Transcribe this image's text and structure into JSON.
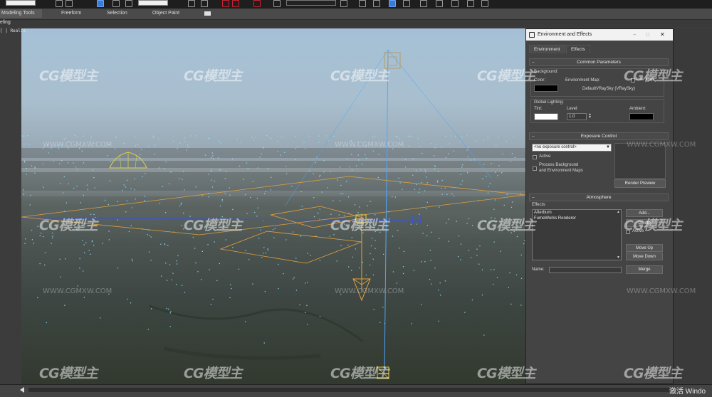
{
  "ribbon": {
    "tabs": [
      "Modeling Tools",
      "Freeform",
      "Selection",
      "Object Paint"
    ],
    "subtab": "eling"
  },
  "viewport": {
    "label": "[ | Realis"
  },
  "dialog": {
    "title": "Environment and Effects",
    "min_btn": "–",
    "max_btn": "□",
    "close_btn": "✕",
    "tabs": [
      "Environment",
      "Effects"
    ],
    "common": {
      "header": "Common Parameters",
      "background": "Background:",
      "color": "Color:",
      "env_map": "Environment Map:",
      "use_map": "Use Map",
      "map_name": "DefaultVRaySky  (VRaySky)",
      "global_lighting": "Global Lighting:",
      "tint": "Tint:",
      "level": "Level:",
      "level_value": "1.0",
      "ambient": "Ambient:"
    },
    "exposure": {
      "header": "Exposure Control",
      "selection": "<no exposure control>",
      "active": "Active",
      "process_bg_line1": "Process Background",
      "process_bg_line2": "and Environment Maps",
      "render_preview": "Render Preview"
    },
    "atmosphere": {
      "header": "Atmosphere",
      "effects_label": "Effects:",
      "effects": [
        "Afterburn",
        "FumeWorks Renderer"
      ],
      "add": "Add...",
      "delete": "Delete",
      "active": "Active",
      "move_up": "Move Up",
      "move_down": "Move Down",
      "name_label": "Name:",
      "merge": "Merge"
    },
    "rollout_minus": "–"
  },
  "watermark": {
    "text": "CG模型主",
    "url": "WWW.CGMXW.COM"
  },
  "status": {
    "activate": "激活 Windo"
  },
  "colors": {
    "dialog_bg": "#444444",
    "accent_blue": "#3a7bd5",
    "gizmo_orange": "#e8a23a",
    "gizmo_yellow": "#d8d04a",
    "axis_blue": "#4aa8ff"
  }
}
